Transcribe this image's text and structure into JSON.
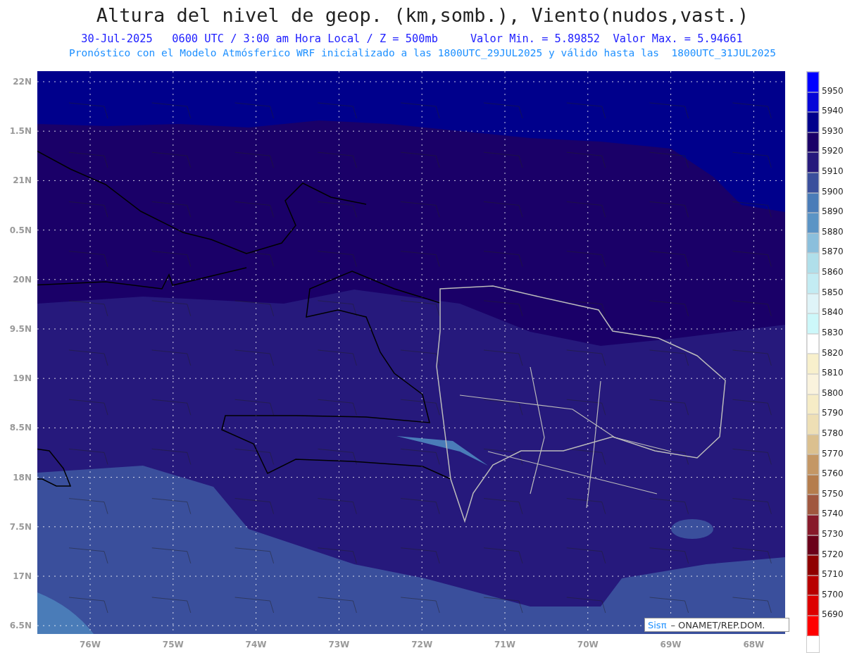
{
  "title": "Altura del nivel de geop. (km,somb.), Viento(nudos,vast.)",
  "subtitle": "30-Jul-2025   0600 UTC / 3:00 am Hora Local / Z = 500mb     Valor Min. = 5.89852  Valor Max. = 5.94661",
  "info_line": "Pronóstico con el Modelo Atmósferico WRF inicializado a las 1800UTC_29JUL2025 y válido hasta las  1800UTC_31JUL2025",
  "map": {
    "lat_labels": [
      "22N",
      "1.5N",
      "21N",
      "0.5N",
      "20N",
      "9.5N",
      "19N",
      "8.5N",
      "18N",
      "7.5N",
      "17N",
      "6.5N"
    ],
    "lon_labels": [
      "76W",
      "75W",
      "74W",
      "73W",
      "72W",
      "71W",
      "70W",
      "69W",
      "68W"
    ]
  },
  "colorbar": [
    {
      "color": "#0000ff",
      "label": "5950"
    },
    {
      "color": "#0606d8",
      "label": "5940"
    },
    {
      "color": "#00008c",
      "label": "5930"
    },
    {
      "color": "#1a0068",
      "label": "5920"
    },
    {
      "color": "#26197c",
      "label": "5910"
    },
    {
      "color": "#3a4f9c",
      "label": "5900"
    },
    {
      "color": "#4a7cb8",
      "label": "5890"
    },
    {
      "color": "#5b94c5",
      "label": "5880"
    },
    {
      "color": "#8bbfdc",
      "label": "5870"
    },
    {
      "color": "#b0dfea",
      "label": "5860"
    },
    {
      "color": "#c3ecf3",
      "label": "5850"
    },
    {
      "color": "#dff4f8",
      "label": "5840"
    },
    {
      "color": "#cdf8fa",
      "label": "5830"
    },
    {
      "color": "#ffffff",
      "label": "5820"
    },
    {
      "color": "#f8f0cc",
      "label": "5810"
    },
    {
      "color": "#faf3dd",
      "label": "5800"
    },
    {
      "color": "#f6ecc6",
      "label": "5790"
    },
    {
      "color": "#eedfb5",
      "label": "5780"
    },
    {
      "color": "#dbc08f",
      "label": "5770"
    },
    {
      "color": "#c49765",
      "label": "5760"
    },
    {
      "color": "#b57d4d",
      "label": "5750"
    },
    {
      "color": "#a0573f",
      "label": "5740"
    },
    {
      "color": "#87192a",
      "label": "5730"
    },
    {
      "color": "#6b0019",
      "label": "5720"
    },
    {
      "color": "#8f0000",
      "label": "5710"
    },
    {
      "color": "#b80000",
      "label": "5700"
    },
    {
      "color": "#dd0000",
      "label": "5690"
    },
    {
      "color": "#ff0000"
    }
  ],
  "credit": {
    "brand": "Sisπ",
    "text": "– ONAMET/REP.DOM."
  }
}
